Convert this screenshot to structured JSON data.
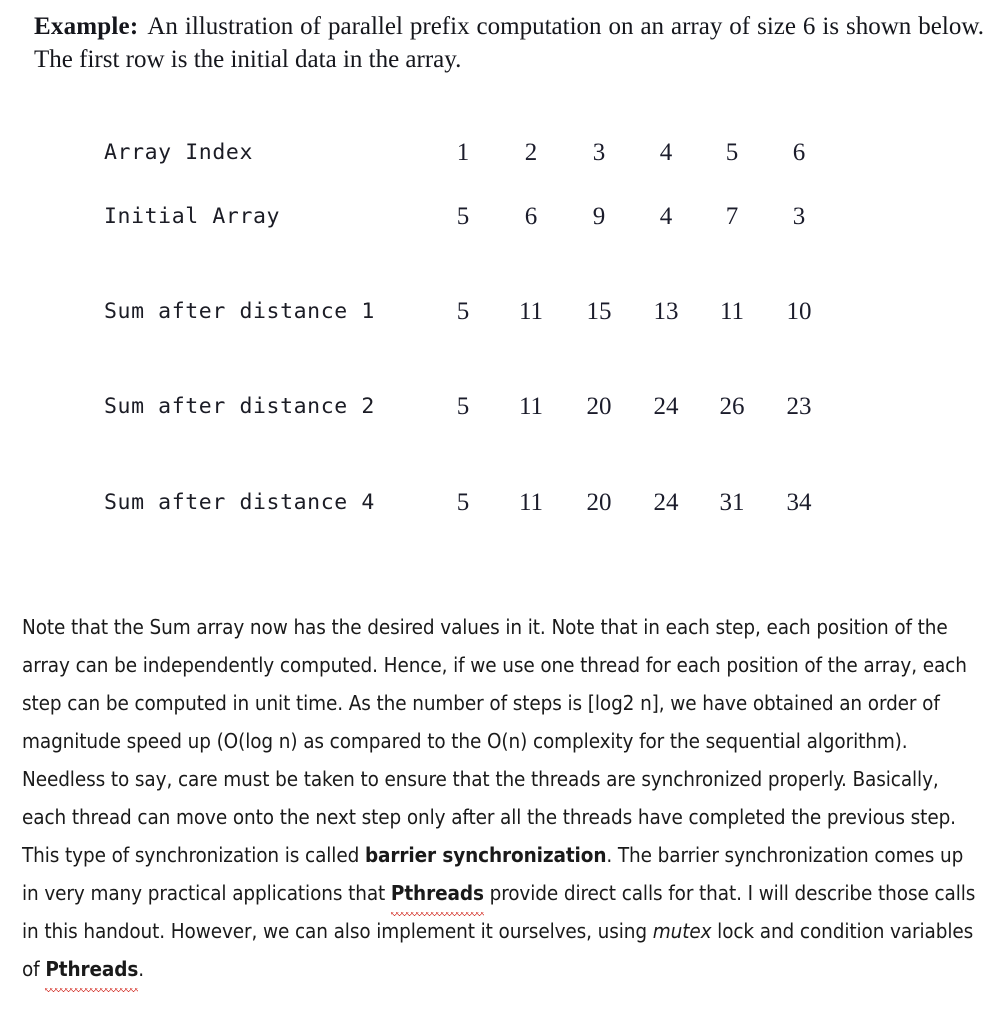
{
  "heading": {
    "lead": "Example:",
    "text": "An illustration of parallel prefix computation on an array of size 6 is shown below. The first row is the initial data in the array."
  },
  "table": {
    "rows": [
      {
        "label": "Array Index",
        "cells": [
          "1",
          "2",
          "3",
          "4",
          "5",
          "6"
        ]
      },
      {
        "label": "Initial Array",
        "cells": [
          "5",
          "6",
          "9",
          "4",
          "7",
          "3"
        ]
      },
      {
        "label": "Sum after distance 1",
        "cells": [
          "5",
          "11",
          "15",
          "13",
          "11",
          "10"
        ]
      },
      {
        "label": "Sum after distance 2",
        "cells": [
          "5",
          "11",
          "20",
          "24",
          "26",
          "23"
        ]
      },
      {
        "label": "Sum after distance 4",
        "cells": [
          "5",
          "11",
          "20",
          "24",
          "31",
          "34"
        ]
      }
    ]
  },
  "body": {
    "p1_a": "Note that the Sum array now has the desired values in it. Note that in each step, each position of the array can be independently computed. Hence, if we use one thread for each position of the array, each step can be computed in unit time. As the number of steps is [log2 n], we have obtained an order of magnitude speed up (O(log n) as compared to the O(n) complexity for the sequential algorithm).",
    "p2_a": "Needless to say, care must be taken to ensure that the threads are synchronized properly. Basically, each thread can move onto the next step only after all the threads have completed the previous step. This type of synchronization is called ",
    "p2_bold1": "barrier synchronization",
    "p2_b": ". The barrier synchronization comes up in very many practical applications that ",
    "p2_bold2": "Pthreads",
    "p2_c": " provide direct calls for that. I will describe those calls in this handout. However, we can also implement it ourselves, using ",
    "p2_italic": "mutex",
    "p2_d": " lock and condition variables of ",
    "p2_bold3": "Pthreads",
    "p2_e": "."
  },
  "colors": {
    "text": "#1a1a1a",
    "spellcheck_underline": "#d63b33",
    "background": "#ffffff"
  }
}
